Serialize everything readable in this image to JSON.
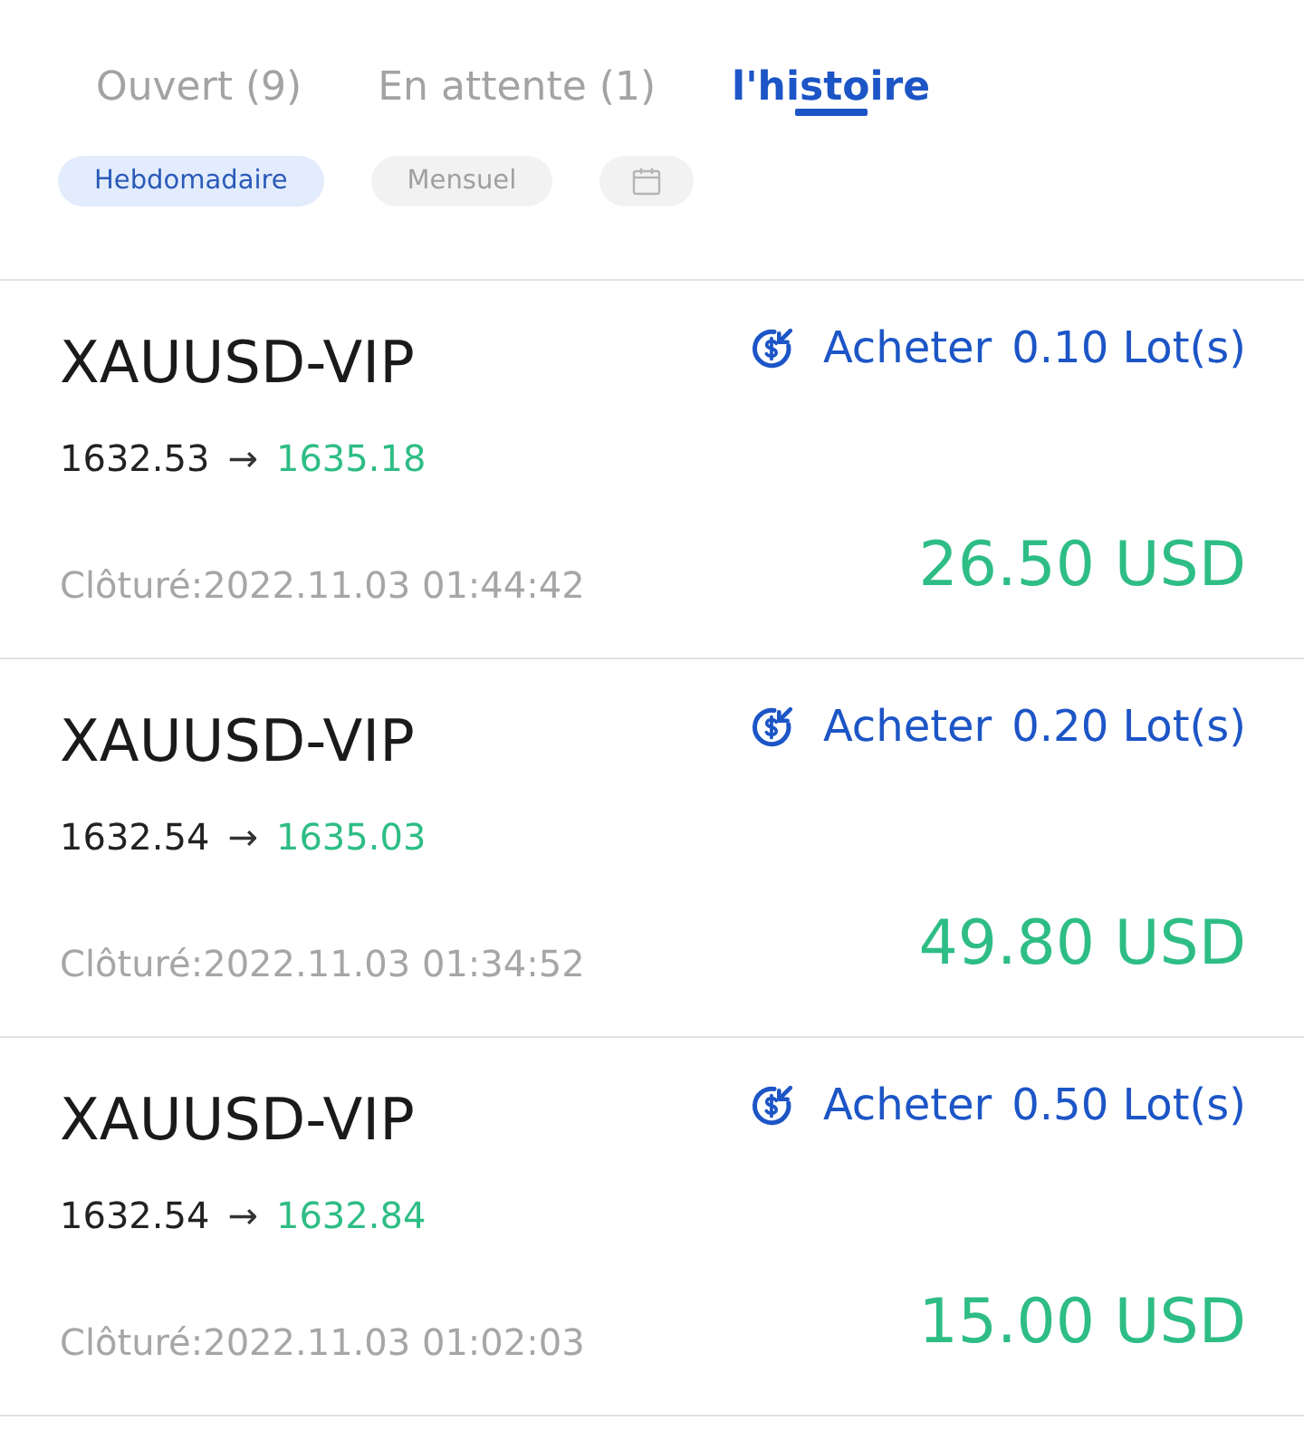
{
  "tabs": [
    {
      "label": "Ouvert (9)",
      "selected": false
    },
    {
      "label": "En attente (1)",
      "selected": false
    },
    {
      "label": "l'histoire",
      "selected": true
    }
  ],
  "filters": [
    {
      "kind": "text",
      "label": "Hebdomadaire",
      "selected": true
    },
    {
      "kind": "text",
      "label": "Mensuel",
      "selected": false
    },
    {
      "kind": "calendar",
      "selected": false
    }
  ],
  "trades": [
    {
      "symbol": "XAUUSD-VIP",
      "side": "Acheter",
      "lots": "0.10 Lot(s)",
      "open_price": "1632.53",
      "arrow": "→",
      "close_price": "1635.18",
      "closed": "Clôturé:2022.11.03 01:44:42",
      "profit": "26.50 USD"
    },
    {
      "symbol": "XAUUSD-VIP",
      "side": "Acheter",
      "lots": "0.20 Lot(s)",
      "open_price": "1632.54",
      "arrow": "→",
      "close_price": "1635.03",
      "closed": "Clôturé:2022.11.03 01:34:52",
      "profit": "49.80 USD"
    },
    {
      "symbol": "XAUUSD-VIP",
      "side": "Acheter",
      "lots": "0.50 Lot(s)",
      "open_price": "1632.54",
      "arrow": "→",
      "close_price": "1632.84",
      "closed": "Clôturé:2022.11.03 01:02:03",
      "profit": "15.00 USD"
    }
  ]
}
